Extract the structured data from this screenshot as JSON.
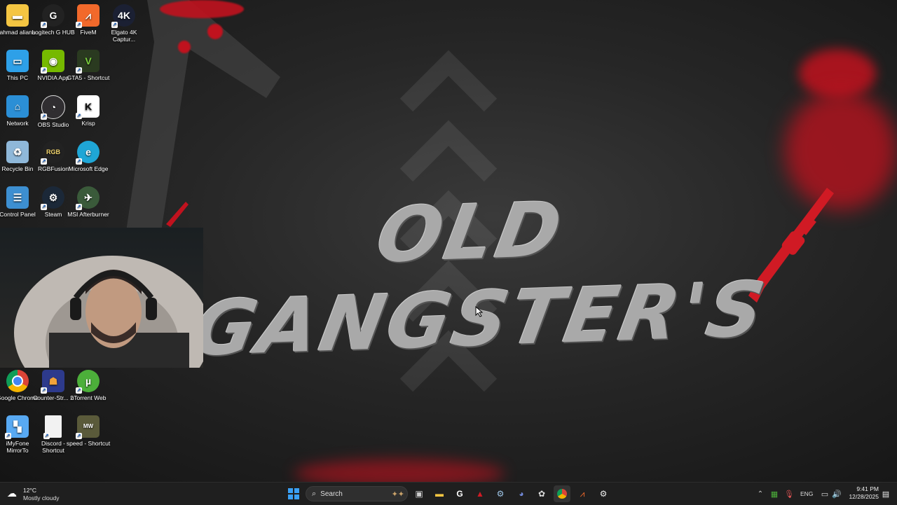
{
  "wallpaper": {
    "title": "OLD GANGSTER'S",
    "accent_color": "#c0121e"
  },
  "desktop": {
    "icons": [
      {
        "label": "ahmad aliana",
        "icon": "folder-icon",
        "color": "#f4c542"
      },
      {
        "label": "Logitech G HUB",
        "icon": "logitech-icon",
        "color": "#222222"
      },
      {
        "label": "FiveM",
        "icon": "fivem-icon",
        "color": "#f2692b"
      },
      {
        "label": "Elgato 4K Captur...",
        "icon": "elgato-icon",
        "color": "#1b2033"
      },
      {
        "label": "This PC",
        "icon": "monitor-icon",
        "color": "#2ea0e8"
      },
      {
        "label": "NVIDIA App",
        "icon": "nvidia-icon",
        "color": "#76b900"
      },
      {
        "label": "GTA5 - Shortcut",
        "icon": "gta-icon",
        "color": "#2a3a20"
      },
      {
        "label": "Network",
        "icon": "network-icon",
        "color": "#2b8fd6"
      },
      {
        "label": "OBS Studio",
        "icon": "obs-icon",
        "color": "#302e31"
      },
      {
        "label": "Krisp",
        "icon": "krisp-icon",
        "color": "#ffffff"
      },
      {
        "label": "Recycle Bin",
        "icon": "recycle-bin-icon",
        "color": "#8fb8d9"
      },
      {
        "label": "RGBFusion",
        "icon": "rgbfusion-icon",
        "color": "#222222"
      },
      {
        "label": "Microsoft Edge",
        "icon": "edge-icon",
        "color": "#1fa6d6"
      },
      {
        "label": "Control Panel",
        "icon": "control-panel-icon",
        "color": "#3d8fd1"
      },
      {
        "label": "Steam",
        "icon": "steam-icon",
        "color": "#1b2838"
      },
      {
        "label": "MSI Afterburner",
        "icon": "msi-icon",
        "color": "#3a5a3a"
      },
      {
        "label": "Google Chrome",
        "icon": "chrome-icon",
        "color": "#db4437"
      },
      {
        "label": "Counter-Str... 2",
        "icon": "cs2-icon",
        "color": "#2d3a8c"
      },
      {
        "label": "uTorrent Web",
        "icon": "utorrent-icon",
        "color": "#4caf3a"
      },
      {
        "label": "iMyFone MirrorTo",
        "icon": "imyfone-icon",
        "color": "#58a9f2"
      },
      {
        "label": "Discord - Shortcut",
        "icon": "file-icon",
        "color": "#f2f2f2"
      },
      {
        "label": "speed - Shortcut",
        "icon": "nfs-icon",
        "color": "#5a5a3a"
      }
    ]
  },
  "taskbar": {
    "weather": {
      "temp": "12°C",
      "condition": "Mostly cloudy"
    },
    "search_label": "Search",
    "pinned": [
      {
        "name": "start-button",
        "icon": "windows-icon"
      },
      {
        "name": "task-view-button",
        "icon": "task-view-icon"
      },
      {
        "name": "file-explorer-button",
        "icon": "folder-icon"
      },
      {
        "name": "logitech-button",
        "icon": "logitech-icon"
      },
      {
        "name": "app-red-button",
        "icon": "triangle-icon"
      },
      {
        "name": "steam-button",
        "icon": "steam-icon"
      },
      {
        "name": "discord-button",
        "icon": "discord-icon"
      },
      {
        "name": "chatgpt-button",
        "icon": "chatgpt-icon"
      },
      {
        "name": "chrome-button",
        "icon": "chrome-icon"
      },
      {
        "name": "fivem-button",
        "icon": "fivem-icon"
      },
      {
        "name": "settings-button",
        "icon": "gear-icon"
      }
    ],
    "tray": {
      "language": "ENG",
      "time": "9:41 PM",
      "date": "12/28/2025"
    }
  }
}
